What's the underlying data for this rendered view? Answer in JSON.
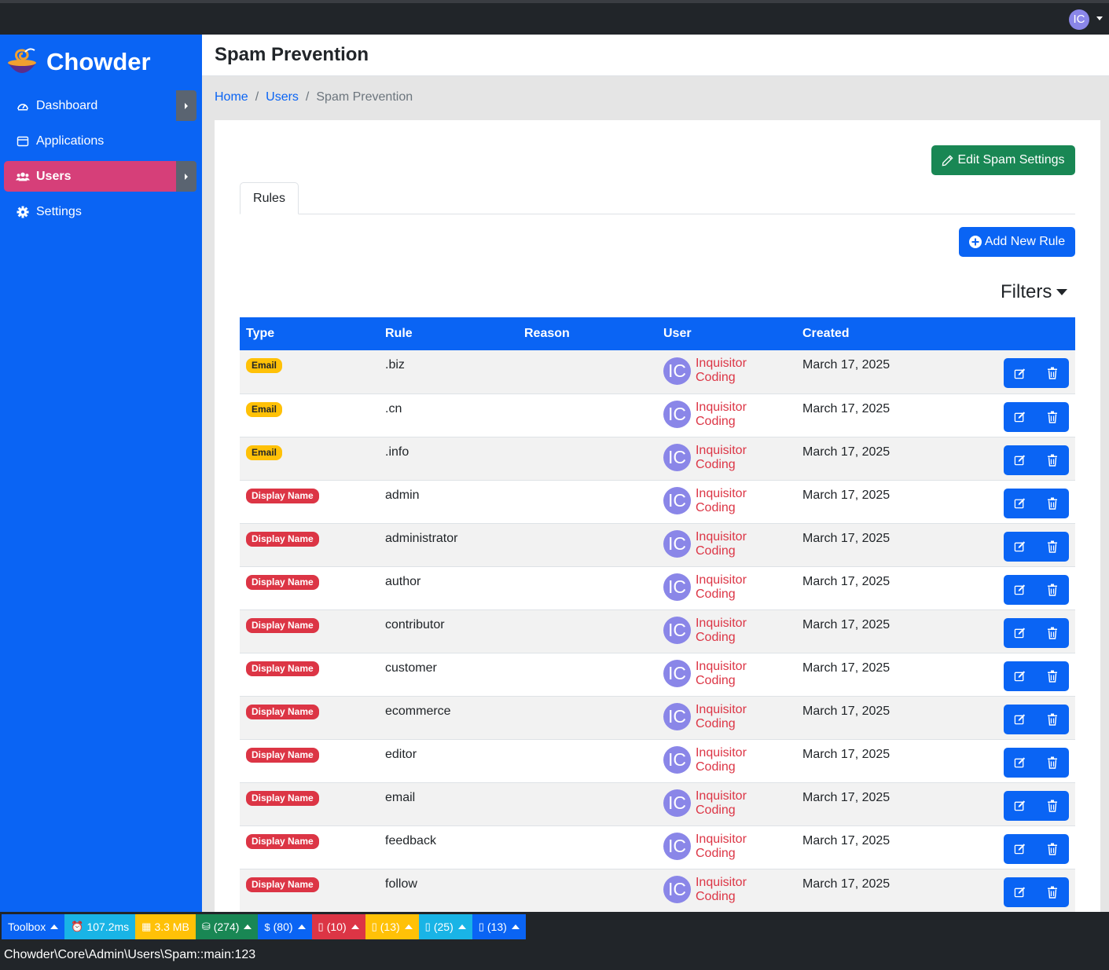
{
  "topbar": {
    "avatar_initials": "IC"
  },
  "brand": {
    "name": "Chowder"
  },
  "sidebar": {
    "items": [
      {
        "label": "Dashboard",
        "icon": "gauge-icon"
      },
      {
        "label": "Applications",
        "icon": "window-icon"
      },
      {
        "label": "Users",
        "icon": "users-icon"
      },
      {
        "label": "Settings",
        "icon": "gear-icon"
      }
    ]
  },
  "header": {
    "title": "Spam Prevention"
  },
  "breadcrumb": {
    "home": "Home",
    "users": "Users",
    "current": "Spam Prevention"
  },
  "card": {
    "edit_settings_label": "Edit Spam Settings",
    "tab_rules": "Rules",
    "add_rule_label": "Add New Rule",
    "filters_label": "Filters"
  },
  "table": {
    "columns": [
      "Type",
      "Rule",
      "Reason",
      "User",
      "Created"
    ],
    "rows": [
      {
        "type": "Email",
        "rule": ".biz",
        "reason": "",
        "user_initials": "IC",
        "user": "Inquisitor Coding",
        "created": "March 17, 2025"
      },
      {
        "type": "Email",
        "rule": ".cn",
        "reason": "",
        "user_initials": "IC",
        "user": "Inquisitor Coding",
        "created": "March 17, 2025"
      },
      {
        "type": "Email",
        "rule": ".info",
        "reason": "",
        "user_initials": "IC",
        "user": "Inquisitor Coding",
        "created": "March 17, 2025"
      },
      {
        "type": "Display Name",
        "rule": "admin",
        "reason": "",
        "user_initials": "IC",
        "user": "Inquisitor Coding",
        "created": "March 17, 2025"
      },
      {
        "type": "Display Name",
        "rule": "administrator",
        "reason": "",
        "user_initials": "IC",
        "user": "Inquisitor Coding",
        "created": "March 17, 2025"
      },
      {
        "type": "Display Name",
        "rule": "author",
        "reason": "",
        "user_initials": "IC",
        "user": "Inquisitor Coding",
        "created": "March 17, 2025"
      },
      {
        "type": "Display Name",
        "rule": "contributor",
        "reason": "",
        "user_initials": "IC",
        "user": "Inquisitor Coding",
        "created": "March 17, 2025"
      },
      {
        "type": "Display Name",
        "rule": "customer",
        "reason": "",
        "user_initials": "IC",
        "user": "Inquisitor Coding",
        "created": "March 17, 2025"
      },
      {
        "type": "Display Name",
        "rule": "ecommerce",
        "reason": "",
        "user_initials": "IC",
        "user": "Inquisitor Coding",
        "created": "March 17, 2025"
      },
      {
        "type": "Display Name",
        "rule": "editor",
        "reason": "",
        "user_initials": "IC",
        "user": "Inquisitor Coding",
        "created": "March 17, 2025"
      },
      {
        "type": "Display Name",
        "rule": "email",
        "reason": "",
        "user_initials": "IC",
        "user": "Inquisitor Coding",
        "created": "March 17, 2025"
      },
      {
        "type": "Display Name",
        "rule": "feedback",
        "reason": "",
        "user_initials": "IC",
        "user": "Inquisitor Coding",
        "created": "March 17, 2025"
      },
      {
        "type": "Display Name",
        "rule": "follow",
        "reason": "",
        "user_initials": "IC",
        "user": "Inquisitor Coding",
        "created": "March 17, 2025"
      }
    ]
  },
  "debugbar": {
    "items": [
      {
        "label": "Toolbox",
        "icon": "",
        "color": "#0a64f4"
      },
      {
        "label": "107.2ms",
        "icon": "alarm-clock-icon",
        "color": "#19b4e6"
      },
      {
        "label": "3.3 MB",
        "icon": "memory-icon",
        "color": "#ffc107"
      },
      {
        "label": "(274)",
        "icon": "database-icon",
        "color": "#198754"
      },
      {
        "label": "(80)",
        "icon": "dollar-icon",
        "color": "#0a64f4"
      },
      {
        "label": "(10)",
        "icon": "html-file-icon",
        "color": "#dc3545"
      },
      {
        "label": "(13)",
        "icon": "css-file-icon",
        "color": "#ffc107"
      },
      {
        "label": "(25)",
        "icon": "js-file-icon",
        "color": "#19b4e6"
      },
      {
        "label": "(13)",
        "icon": "json-file-icon",
        "color": "#0a64f4"
      }
    ],
    "path": "Chowder\\Core\\Admin\\Users\\Spam::main:123"
  }
}
